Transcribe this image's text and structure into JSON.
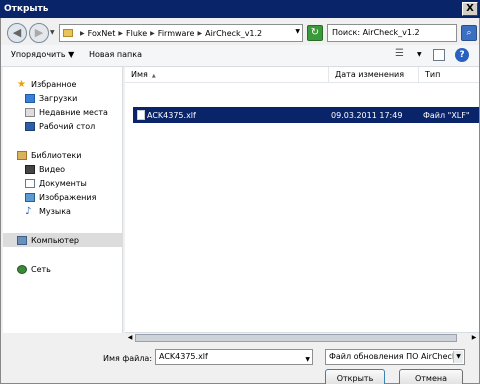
{
  "window": {
    "title": "Открыть",
    "close_glyph": "X"
  },
  "nav": {
    "back_glyph": "◀",
    "forward_glyph": "▶",
    "breadcrumbs": [
      "FoxNet",
      "Fluke",
      "Firmware",
      "AirCheck_v1.2"
    ],
    "search_text": "Поиск: AirCheck_v1.2"
  },
  "toolbar": {
    "organize_label": "Упорядочить ▼",
    "new_folder_label": "Новая папка"
  },
  "sidebar": {
    "favorites_label": "Избранное",
    "favorites": [
      "Загрузки",
      "Недавние места",
      "Рабочий стол"
    ],
    "libraries_label": "Библиотеки",
    "libraries": [
      "Видео",
      "Документы",
      "Изображения",
      "Музыка"
    ],
    "computer_label": "Компьютер",
    "network_label": "Сеть"
  },
  "columns": {
    "name": "Имя",
    "date": "Дата изменения",
    "type": "Тип"
  },
  "files": [
    {
      "name": "ACK4375.xlf",
      "date": "09.03.2011 17:49",
      "type": "Файл \"XLF\"",
      "selected": true
    }
  ],
  "bottom": {
    "filename_label": "Имя файла:",
    "filename_value": "ACK4375.xlf",
    "filetype_value": "Файл обновления ПО AirCheck",
    "open_button": "Открыть",
    "cancel_button": "Отмена"
  },
  "colors": {
    "selection": "#0a246a",
    "titlebar": "#0a246a"
  }
}
